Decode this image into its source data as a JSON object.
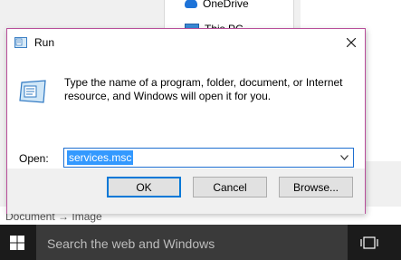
{
  "background": {
    "explorer_items": [
      {
        "label": "OneDrive",
        "icon": "onedrive-icon"
      },
      {
        "label": "This PC",
        "icon": "this-pc-icon"
      }
    ],
    "doc_path": "Document  →  Image"
  },
  "dialog": {
    "title": "Run",
    "description": "Type the name of a program, folder, document, or Internet resource, and Windows will open it for you.",
    "open_label": "Open:",
    "open_value": "services.msc",
    "buttons": {
      "ok": "OK",
      "cancel": "Cancel",
      "browse": "Browse..."
    },
    "accent": "#0078d7",
    "border": "#b84e9a"
  },
  "taskbar": {
    "search_placeholder": "Search the web and Windows"
  }
}
